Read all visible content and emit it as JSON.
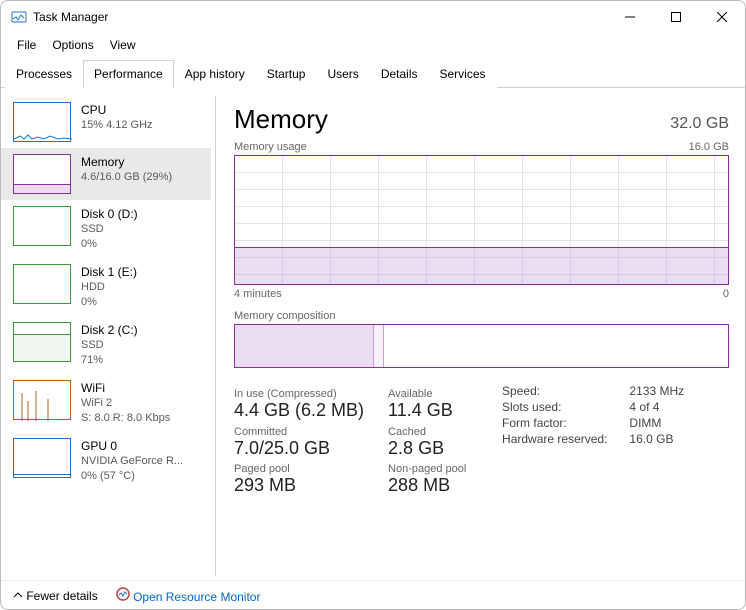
{
  "window": {
    "title": "Task Manager"
  },
  "menu": {
    "file": "File",
    "options": "Options",
    "view": "View"
  },
  "tabs": {
    "processes": "Processes",
    "performance": "Performance",
    "apphistory": "App history",
    "startup": "Startup",
    "users": "Users",
    "details": "Details",
    "services": "Services"
  },
  "nav": {
    "cpu": {
      "title": "CPU",
      "sub1": "15% 4.12 GHz"
    },
    "mem": {
      "title": "Memory",
      "sub1": "4.6/16.0 GB (29%)"
    },
    "disk0": {
      "title": "Disk 0 (D:)",
      "sub1": "SSD",
      "sub2": "0%"
    },
    "disk1": {
      "title": "Disk 1 (E:)",
      "sub1": "HDD",
      "sub2": "0%"
    },
    "disk2": {
      "title": "Disk 2 (C:)",
      "sub1": "SSD",
      "sub2": "71%"
    },
    "wifi": {
      "title": "WiFi",
      "sub1": "WiFi 2",
      "sub2": "S: 8.0 R: 8.0 Kbps"
    },
    "gpu": {
      "title": "GPU 0",
      "sub1": "NVIDIA GeForce R...",
      "sub2": "0% (57 °C)"
    }
  },
  "main": {
    "title": "Memory",
    "total": "32.0 GB",
    "usage_label": "Memory usage",
    "usage_max": "16.0 GB",
    "axis_left": "4 minutes",
    "axis_right": "0",
    "comp_label": "Memory composition",
    "stats": {
      "inuse_lbl": "In use (Compressed)",
      "inuse_val": "4.4 GB (6.2 MB)",
      "avail_lbl": "Available",
      "avail_val": "11.4 GB",
      "committed_lbl": "Committed",
      "committed_val": "7.0/25.0 GB",
      "cached_lbl": "Cached",
      "cached_val": "2.8 GB",
      "paged_lbl": "Paged pool",
      "paged_val": "293 MB",
      "nonpaged_lbl": "Non-paged pool",
      "nonpaged_val": "288 MB"
    },
    "hw": {
      "speed_lbl": "Speed:",
      "speed_val": "2133 MHz",
      "slots_lbl": "Slots used:",
      "slots_val": "4 of 4",
      "form_lbl": "Form factor:",
      "form_val": "DIMM",
      "reserved_lbl": "Hardware reserved:",
      "reserved_val": "16.0 GB"
    }
  },
  "footer": {
    "fewer": "Fewer details",
    "openres": "Open Resource Monitor"
  },
  "chart_data": {
    "type": "line",
    "title": "Memory usage",
    "ylabel": "GB",
    "ylim": [
      0,
      16
    ],
    "x": [
      "4 minutes",
      "0"
    ],
    "series": [
      {
        "name": "Memory",
        "values_gb_estimate": 4.6,
        "flat": true
      }
    ],
    "composition": {
      "in_use_gb": 4.4,
      "cached_gb": 2.8,
      "available_gb": 11.4,
      "total_gb": 16.0
    }
  }
}
